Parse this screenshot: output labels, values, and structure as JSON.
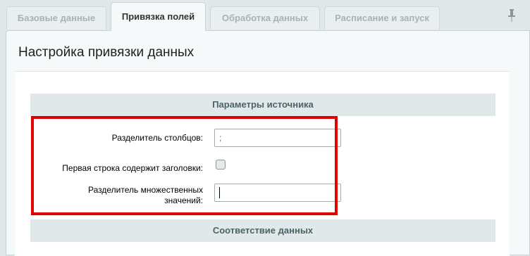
{
  "tabs": [
    {
      "label": "Базовые данные",
      "active": false
    },
    {
      "label": "Привязка полей",
      "active": true
    },
    {
      "label": "Обработка данных",
      "active": false
    },
    {
      "label": "Расписание и запуск",
      "active": false
    }
  ],
  "pin_icon": "pin-icon",
  "page": {
    "title": "Настройка привязки данных"
  },
  "source_section": {
    "title": "Параметры источника",
    "column_separator": {
      "label": "Разделитель столбцов:",
      "value": ";"
    },
    "first_row_headers": {
      "label": "Первая строка содержит заголовки:",
      "checked": false
    },
    "multi_value_separator": {
      "label_line1": "Разделитель множественных",
      "label_line2": "значений:",
      "value": ""
    }
  },
  "mapping_section": {
    "title": "Соответствие данных"
  },
  "colors": {
    "highlight": "#e00000",
    "section_header": "#e0e8ea"
  }
}
